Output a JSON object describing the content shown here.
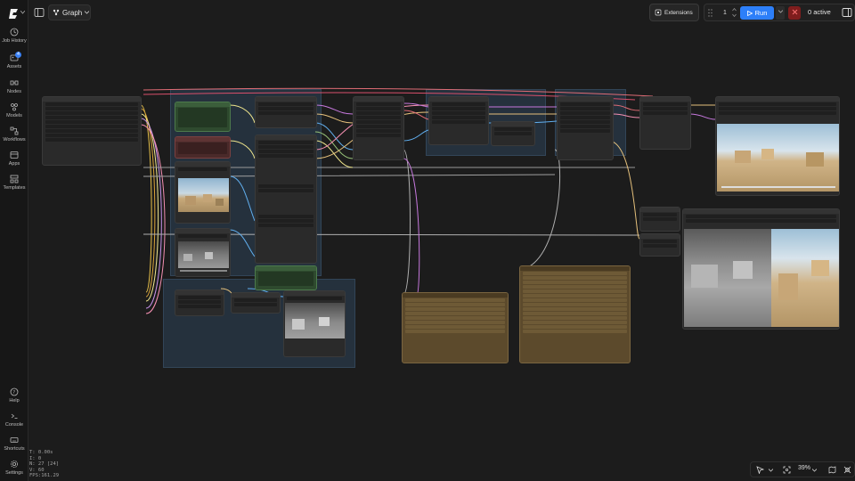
{
  "app": {
    "logo_icon": "comfy-logo-icon"
  },
  "sidebar": {
    "items": [
      {
        "name": "job-history",
        "label": "Job History",
        "icon": "history-icon"
      },
      {
        "name": "assets",
        "label": "Assets",
        "icon": "assets-icon",
        "badge": "4"
      },
      {
        "name": "nodes",
        "label": "Nodes",
        "icon": "nodes-icon"
      },
      {
        "name": "models",
        "label": "Models",
        "icon": "models-icon"
      },
      {
        "name": "workflows",
        "label": "Workflows",
        "icon": "workflows-icon"
      },
      {
        "name": "apps",
        "label": "Apps",
        "icon": "apps-icon"
      },
      {
        "name": "templates",
        "label": "Templates",
        "icon": "templates-icon"
      }
    ],
    "bottom_items": [
      {
        "name": "help",
        "label": "Help",
        "icon": "help-icon"
      },
      {
        "name": "console",
        "label": "Console",
        "icon": "console-icon"
      },
      {
        "name": "shortcuts",
        "label": "Shortcuts",
        "icon": "keyboard-icon"
      },
      {
        "name": "settings",
        "label": "Settings",
        "icon": "gear-icon"
      }
    ]
  },
  "stats": {
    "t": "T: 0.00s",
    "i": "I: 0",
    "n": "N: 27 [24]",
    "v": "V: 60",
    "fps": "FPS:161.29"
  },
  "topbar": {
    "graph_tab": "Graph",
    "extensions_label": "Extensions",
    "queue_count": "1",
    "run_label": "Run",
    "active_label": "0 active"
  },
  "bottom_controls": {
    "zoom": "39%"
  },
  "colors": {
    "accent": "#2d7ff9",
    "group": "#3b628c",
    "note": "#5c4a2c",
    "prompt_positive": "#2e4a2e",
    "prompt_negative": "#4a2a2a"
  }
}
